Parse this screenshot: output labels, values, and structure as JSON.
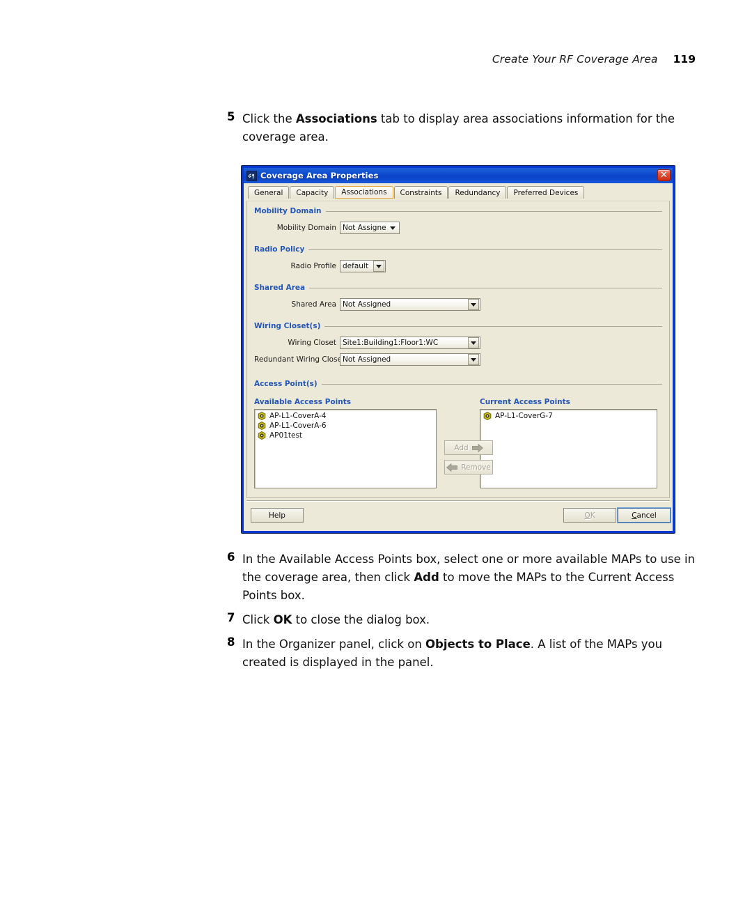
{
  "header": {
    "title": "Create Your RF Coverage Area",
    "page_number": "119"
  },
  "steps": [
    {
      "number": "5",
      "text_parts": [
        {
          "t": "Click the ",
          "b": false
        },
        {
          "t": "Associations",
          "b": true
        },
        {
          "t": " tab to display area associations information for the coverage area.",
          "b": false
        }
      ]
    },
    {
      "number": "6",
      "text_parts": [
        {
          "t": "In the Available Access Points box, select one or more available MAPs to use in the coverage area, then click ",
          "b": false
        },
        {
          "t": "Add",
          "b": true
        },
        {
          "t": " to move the MAPs to the Current Access Points box.",
          "b": false
        }
      ]
    },
    {
      "number": "7",
      "text_parts": [
        {
          "t": "Click ",
          "b": false
        },
        {
          "t": "OK",
          "b": true
        },
        {
          "t": " to close the dialog box.",
          "b": false
        }
      ]
    },
    {
      "number": "8",
      "text_parts": [
        {
          "t": "In the Organizer panel, click on ",
          "b": false
        },
        {
          "t": "Objects to Place",
          "b": true
        },
        {
          "t": ". A list of the MAPs you created is displayed in the panel.",
          "b": false
        }
      ]
    }
  ],
  "dialog": {
    "title": "Coverage Area Properties",
    "app_icon": "wireless-ap-icon",
    "close_label": "✕",
    "tabs": [
      {
        "label": "General",
        "selected": false
      },
      {
        "label": "Capacity",
        "selected": false
      },
      {
        "label": "Associations",
        "selected": true
      },
      {
        "label": "Constraints",
        "selected": false
      },
      {
        "label": "Redundancy",
        "selected": false
      },
      {
        "label": "Preferred Devices",
        "selected": false
      }
    ],
    "groups": {
      "mobility_domain": {
        "title": "Mobility Domain",
        "field_label": "Mobility Domain",
        "value": "Not Assigned"
      },
      "radio_policy": {
        "title": "Radio Policy",
        "field_label": "Radio Profile",
        "value": "default"
      },
      "shared_area": {
        "title": "Shared Area",
        "field_label": "Shared Area",
        "value": "Not Assigned"
      },
      "wiring_closets": {
        "title": "Wiring Closet(s)",
        "wiring_closet_label": "Wiring Closet",
        "wiring_closet_value": "Site1:Building1:Floor1:WC",
        "redundant_label": "Redundant Wiring Closet",
        "redundant_value": "Not Assigned"
      },
      "access_points": {
        "title": "Access Point(s)",
        "available_label": "Available Access Points",
        "current_label": "Current Access Points",
        "available_items": [
          "AP-L1-CoverA-4",
          "AP-L1-CoverA-6",
          "AP01test"
        ],
        "current_items": [
          "AP-L1-CoverG-7"
        ],
        "add_label": "Add",
        "remove_label": "Remove"
      }
    },
    "buttons": {
      "help": "Help",
      "ok": "OK",
      "ok_mnemonic": "O",
      "ok_rest": "K",
      "cancel_mnemonic": "C",
      "cancel_rest": "ancel"
    },
    "colors": {
      "titlebar_blue": "#0c49cf",
      "window_border": "#0a38d2",
      "group_heading": "#2356b8",
      "face": "#ece9d8",
      "selected_tab_border": "#e8a33d",
      "close_red": "#cc2d14",
      "ap_icon": "#c9bc1c"
    }
  }
}
